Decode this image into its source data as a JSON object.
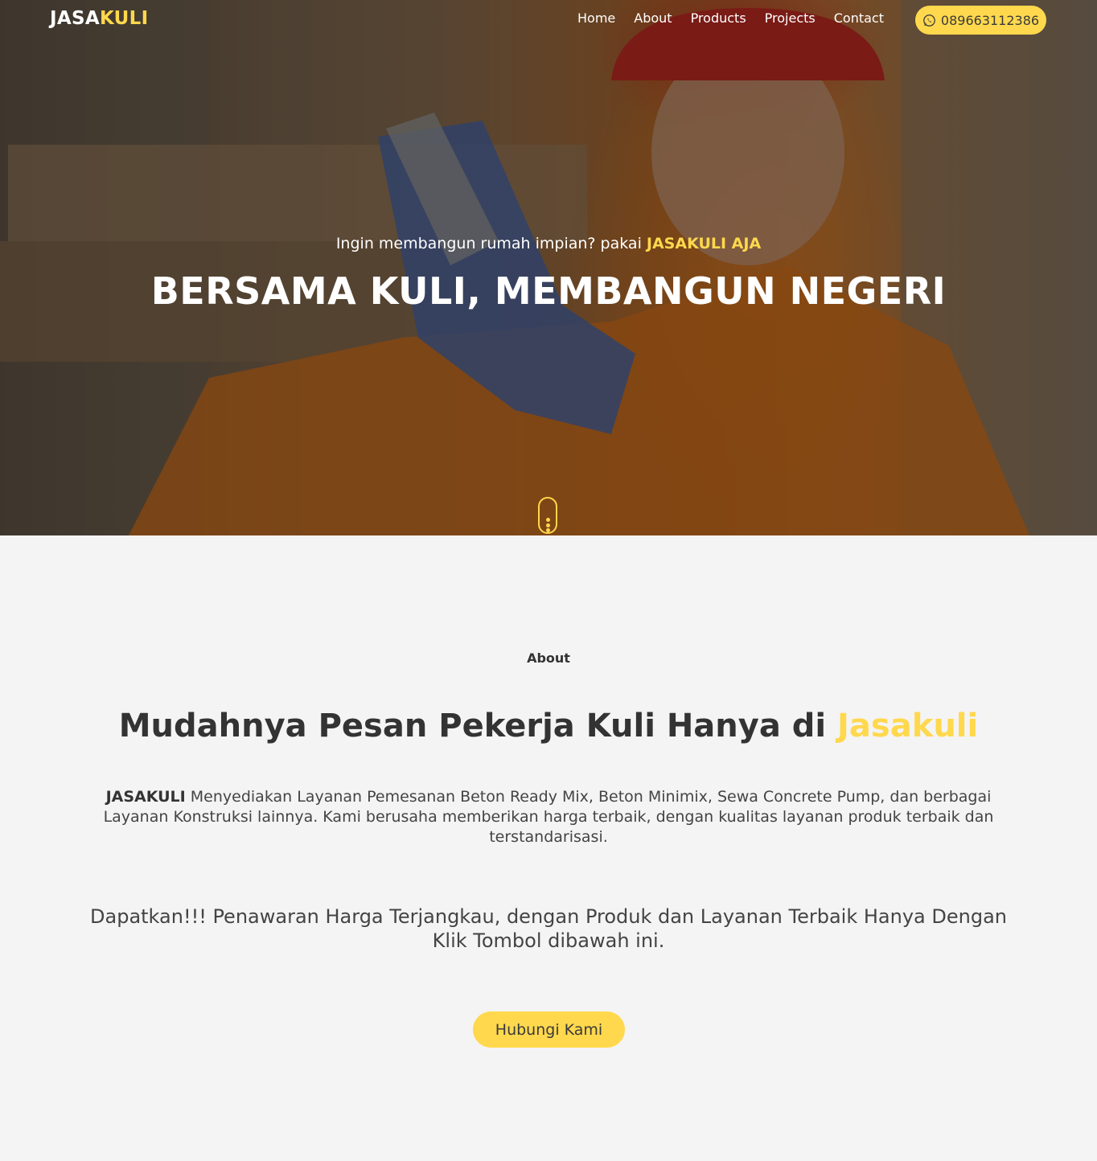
{
  "brand": {
    "prefix": "JASA",
    "accent": "KULI"
  },
  "nav": {
    "items": [
      {
        "label": "Home"
      },
      {
        "label": "About"
      },
      {
        "label": "Products"
      },
      {
        "label": "Projects"
      },
      {
        "label": "Contact"
      }
    ],
    "phone": {
      "icon": "whatsapp-icon",
      "number": "089663112386"
    }
  },
  "hero": {
    "subtitle_text": "Ingin membangun rumah impian? pakai",
    "subtitle_accent": "JASAKULI AJA",
    "title": "BERSAMA KULI, MEMBANGUN NEGERI",
    "scroll_icon": "mouse-scroll-icon"
  },
  "about": {
    "label": "About",
    "title_text": "Mudahnya Pesan Pekerja Kuli Hanya di",
    "title_accent": "Jasakuli",
    "desc_brand": "JASAKULI",
    "desc_text": "Menyediakan Layanan Pemesanan Beton Ready Mix, Beton Minimix, Sewa Concrete Pump, dan berbagai Layanan Konstruksi lainnya. Kami berusaha memberikan harga terbaik, dengan kualitas layanan produk terbaik dan terstandarisasi.",
    "offer": "Dapatkan!!! Penawaran Harga Terjangkau, dengan Produk dan Layanan Terbaik Hanya Dengan Klik Tombol dibawah ini.",
    "cta_label": "Hubungi Kami"
  },
  "colors": {
    "accent": "#ffd84d",
    "text": "#333333",
    "background": "#f4f4f4",
    "hero_overlay": "#000000"
  }
}
